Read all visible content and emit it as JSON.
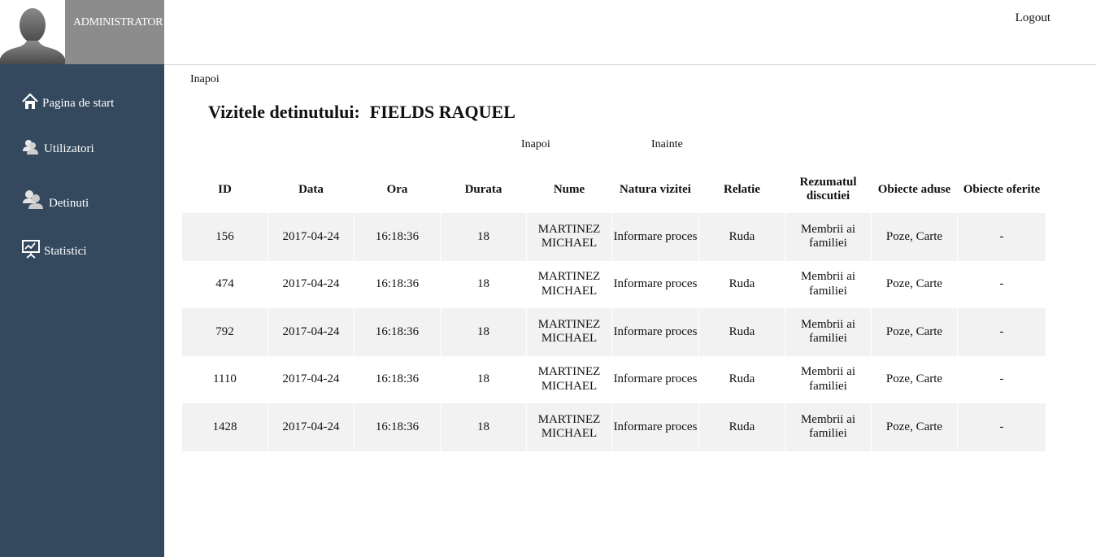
{
  "sidebar": {
    "admin_name": "ADMINISTRATOR",
    "avatar_icon": "user-silhouette-icon",
    "items": [
      {
        "label": "Pagina de start",
        "icon": "home-icon"
      },
      {
        "label": "Utilizatori",
        "icon": "users-icon"
      },
      {
        "label": "Detinuti",
        "icon": "group-icon"
      },
      {
        "label": "Statistici",
        "icon": "chart-presentation-icon"
      }
    ],
    "bg_color": "#34495e"
  },
  "header": {
    "logout_label": "Logout"
  },
  "main": {
    "back_label": "Inapoi",
    "title_prefix": "Vizitele detinutului:",
    "title_name": "FIELDS RAQUEL",
    "pager": {
      "prev_label": "Inapoi",
      "next_label": "Inainte"
    },
    "table": {
      "columns": [
        "ID",
        "Data",
        "Ora",
        "Durata",
        "Nume",
        "Natura vizitei",
        "Relatie",
        "Rezumatul discutiei",
        "Obiecte aduse",
        "Obiecte oferite"
      ],
      "rows": [
        [
          "156",
          "2017-04-24",
          "16:18:36",
          "18",
          "MARTINEZ MICHAEL",
          "Informare proces",
          "Ruda",
          "Membrii ai familiei",
          "Poze, Carte",
          "-"
        ],
        [
          "474",
          "2017-04-24",
          "16:18:36",
          "18",
          "MARTINEZ MICHAEL",
          "Informare proces",
          "Ruda",
          "Membrii ai familiei",
          "Poze, Carte",
          "-"
        ],
        [
          "792",
          "2017-04-24",
          "16:18:36",
          "18",
          "MARTINEZ MICHAEL",
          "Informare proces",
          "Ruda",
          "Membrii ai familiei",
          "Poze, Carte",
          "-"
        ],
        [
          "1110",
          "2017-04-24",
          "16:18:36",
          "18",
          "MARTINEZ MICHAEL",
          "Informare proces",
          "Ruda",
          "Membrii ai familiei",
          "Poze, Carte",
          "-"
        ],
        [
          "1428",
          "2017-04-24",
          "16:18:36",
          "18",
          "MARTINEZ MICHAEL",
          "Informare proces",
          "Ruda",
          "Membrii ai familiei",
          "Poze, Carte",
          "-"
        ]
      ]
    }
  }
}
